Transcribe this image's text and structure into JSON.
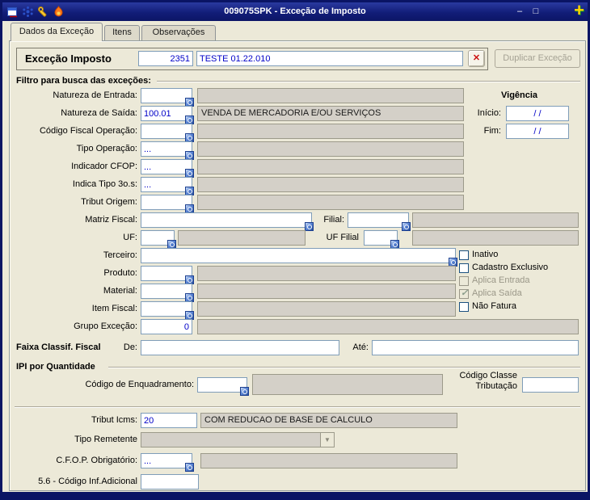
{
  "titlebar": {
    "title": "009075SPK - Exceção de Imposto",
    "minimize": "–",
    "maximize": "□",
    "plus": "+"
  },
  "icons": {
    "titlebar": [
      "app-window-icon",
      "molecule-icon",
      "wrench-icon",
      "flame-icon"
    ],
    "field_lookup": "lookup-zoom-icon",
    "delete": "red-x-icon",
    "combo_arrow": "chevron-down-icon"
  },
  "tabs": [
    {
      "label": "Dados da Exceção",
      "active": true
    },
    {
      "label": "Itens",
      "active": false
    },
    {
      "label": "Observações",
      "active": false
    }
  ],
  "header": {
    "label": "Exceção Imposto",
    "code": "2351",
    "description": "TESTE 01.22.010",
    "delete_glyph": "✕",
    "duplicate_label": "Duplicar Exceção"
  },
  "filter": {
    "title": "Filtro para busca das exceções:",
    "vigencia": {
      "title": "Vigência",
      "inicio_label": "Início:",
      "inicio_value": "/ /",
      "fim_label": "Fim:",
      "fim_value": "/ /"
    },
    "natureza_entrada": {
      "label": "Natureza de Entrada:",
      "value": "",
      "desc": ""
    },
    "natureza_saida": {
      "label": "Natureza de Saída:",
      "value": "100.01",
      "desc": "VENDA DE MERCADORIA E/OU SERVIÇOS"
    },
    "codigo_fiscal": {
      "label": "Código Fiscal Operação:",
      "value": "",
      "desc": ""
    },
    "tipo_operacao": {
      "label": "Tipo Operação:",
      "value": "...",
      "desc": ""
    },
    "indicador_cfop": {
      "label": "Indicador CFOP:",
      "value": "...",
      "desc": ""
    },
    "indica_tipo_3os": {
      "label": "Indica Tipo 3o.s:",
      "value": "...",
      "desc": ""
    },
    "tribut_origem": {
      "label": "Tribut Origem:",
      "value": "",
      "desc": ""
    },
    "matriz_fiscal": {
      "label": "Matriz Fiscal:",
      "value": ""
    },
    "filial": {
      "label": "Filial:",
      "value": "",
      "desc": ""
    },
    "uf": {
      "label": "UF:",
      "value": "",
      "desc": ""
    },
    "uf_filial": {
      "label": "UF Filial",
      "value": "",
      "desc": ""
    },
    "terceiro": {
      "label": "Terceiro:",
      "value": ""
    },
    "produto": {
      "label": "Produto:",
      "value": "",
      "desc": ""
    },
    "material": {
      "label": "Material:",
      "value": "",
      "desc": ""
    },
    "item_fiscal": {
      "label": "Item Fiscal:",
      "value": "",
      "desc": ""
    },
    "grupo_excecao": {
      "label": "Grupo Exceção:",
      "value": "0",
      "desc": ""
    },
    "checkboxes": [
      {
        "label": "Inativo",
        "checked": false,
        "disabled": false
      },
      {
        "label": "Cadastro Exclusivo",
        "checked": false,
        "disabled": false
      },
      {
        "label": "Aplica Entrada",
        "checked": false,
        "disabled": true
      },
      {
        "label": "Aplica Saída",
        "checked": true,
        "disabled": true
      },
      {
        "label": "Não Fatura",
        "checked": false,
        "disabled": false
      }
    ]
  },
  "faixa": {
    "title": "Faixa Classif. Fiscal",
    "de_label": "De:",
    "de_value": "",
    "ate_label": "Até:",
    "ate_value": ""
  },
  "ipi": {
    "title": "IPI por Quantidade",
    "enquadramento_label": "Código de Enquadramento:",
    "enquadramento_value": "",
    "enquadramento_desc": "",
    "classe_label": "Código Classe Tributação",
    "classe_value": ""
  },
  "bottom": {
    "tribut_icms": {
      "label": "Tribut Icms:",
      "value": "20",
      "desc": "COM REDUCAO DE BASE DE CALCULO"
    },
    "tipo_remetente": {
      "label": "Tipo Remetente",
      "value": ""
    },
    "cfop_obrigatorio": {
      "label": "C.F.O.P. Obrigatório:",
      "value": "...",
      "desc": ""
    },
    "codigo_inf_adicional": {
      "label": "5.6 - Código Inf.Adicional",
      "value": ""
    }
  },
  "colors": {
    "titlebar": "#121d78",
    "window_bg": "#ece9d8",
    "disabled_field": "#d4d0c8",
    "value_text": "#0000c8",
    "accent_plus": "#ffd400",
    "delete_red": "#cc1111"
  }
}
